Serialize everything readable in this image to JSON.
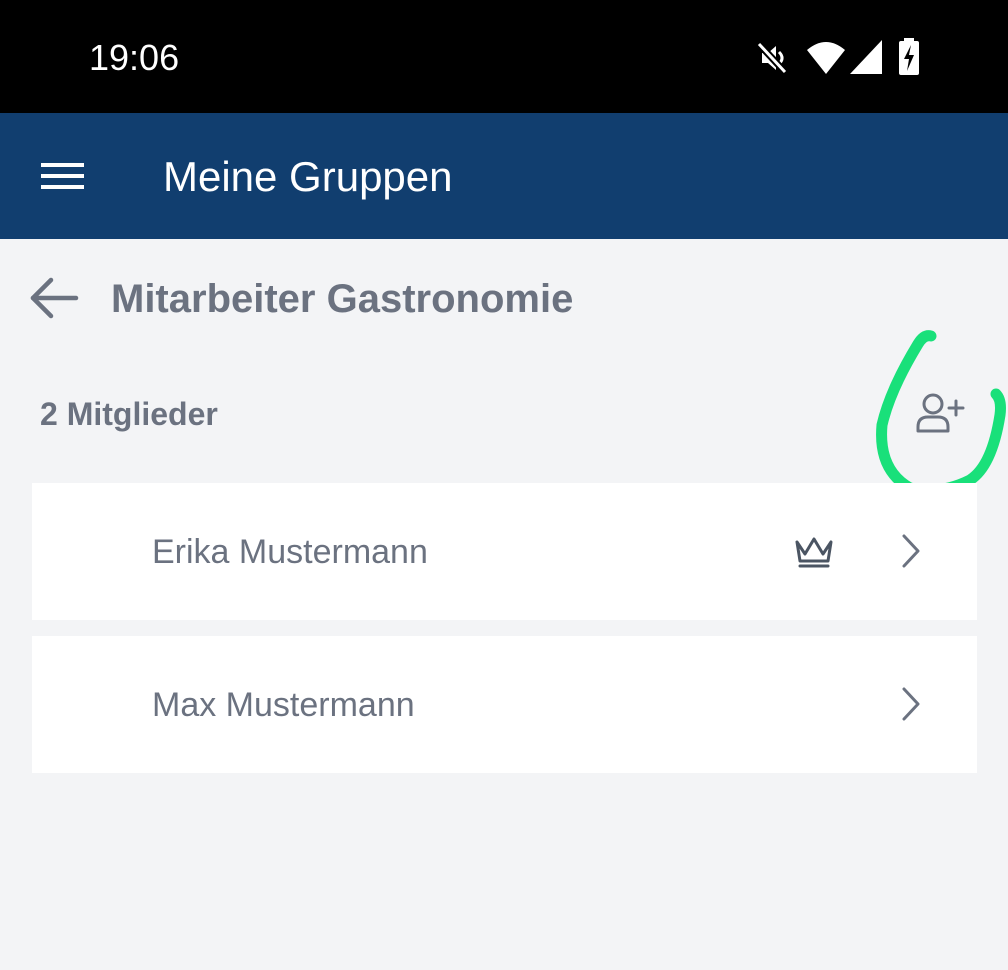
{
  "status_bar": {
    "time": "19:06",
    "icons": [
      "mute-icon",
      "wifi-icon",
      "signal-icon",
      "battery-charging-icon"
    ]
  },
  "app_bar": {
    "title": "Meine Gruppen",
    "menu_icon": "menu-icon"
  },
  "group": {
    "title": "Mitarbeiter Gastronomie",
    "member_count": "2 Mitglieder",
    "back_icon": "arrow-left-icon",
    "add_member_icon": "user-plus-icon"
  },
  "members": [
    {
      "name": "Erika Mustermann",
      "is_owner": true
    },
    {
      "name": "Max Mustermann",
      "is_owner": false
    }
  ],
  "colors": {
    "app_bar": "#113e6f",
    "background": "#f3f4f6",
    "text_muted": "#6b7280",
    "annotation": "#19e07a"
  }
}
